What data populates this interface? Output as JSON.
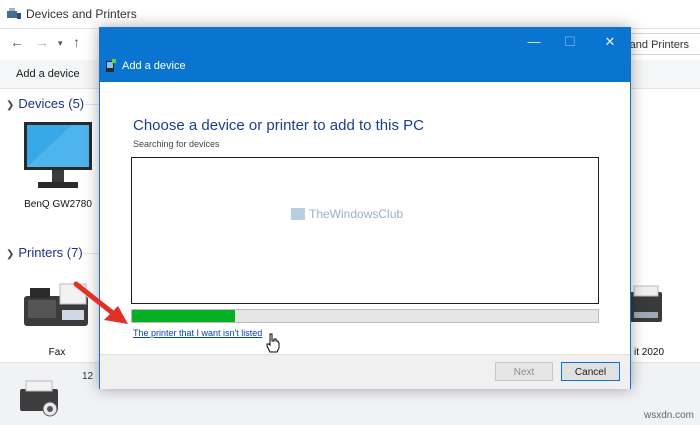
{
  "explorer": {
    "title": "Devices and Printers",
    "search_text": "es and Printers",
    "command": "Add a device",
    "devices_header": "Devices (5)",
    "printers_header": "Printers (7)",
    "device_labels": {
      "monitor": "BenQ GW2780",
      "fax": "Fax",
      "right_printer": "it 2020"
    },
    "bottom_count": "12"
  },
  "dialog": {
    "title": "Add a device",
    "heading": "Choose a device or printer to add to this PC",
    "status": "Searching for devices",
    "watermark": "TheWindowsClub",
    "progress_fraction": 0.22,
    "not_listed_link": "The printer that I want isn't listed",
    "next_label": "Next",
    "cancel_label": "Cancel",
    "window_buttons": {
      "minimize": "—",
      "maximize": "☐",
      "close": "✕"
    }
  },
  "page_footer": "wsxdn.com",
  "colors": {
    "dialog_titlebar": "#0a74d1",
    "progress": "#06b025",
    "link": "#0047a8",
    "heading": "#1a3f8a",
    "arrow": "#e03127"
  },
  "icons": [
    "devices-printers-icon",
    "back-arrow-icon",
    "forward-arrow-icon",
    "up-arrow-icon",
    "monitor-icon",
    "fax-icon",
    "printer-icon",
    "add-device-icon",
    "hand-cursor-icon",
    "red-arrow-icon"
  ]
}
